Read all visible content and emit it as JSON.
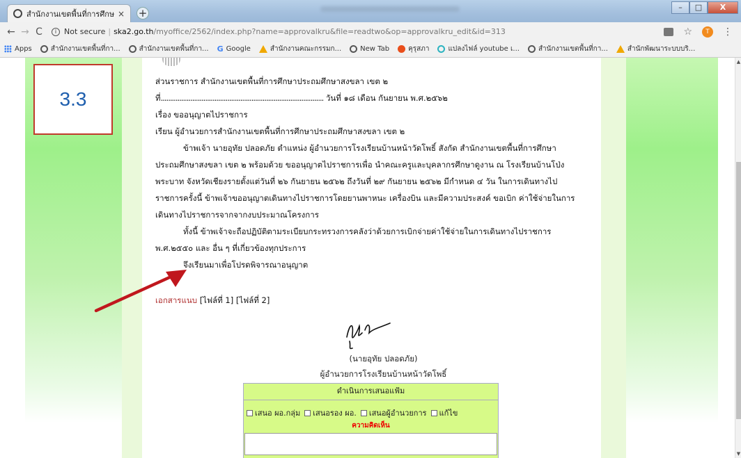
{
  "browser": {
    "tab_title": "สำนักงานเขตพื้นที่การศึกษาประถม",
    "tab_close": "×",
    "new_tab": "+",
    "window_buttons": {
      "minimize": "–",
      "maximize": "□",
      "close": "X"
    },
    "nav": {
      "back": "←",
      "forward": "→",
      "reload": "C"
    },
    "security_label": "Not secure",
    "url_host": "ska2.go.th",
    "url_path": "/myoffice/2562/index.php?name=approvalkru&file=readtwo&op=approvalkru_edit&id=313",
    "profile_initial": "T",
    "star": "☆",
    "menu": "⋮",
    "bookmarks": [
      {
        "icon": "apps-grid-icon",
        "label": "Apps"
      },
      {
        "icon": "globe-icon",
        "label": "สำนักงานเขตพื้นที่กา..."
      },
      {
        "icon": "globe-icon",
        "label": "สำนักงานเขตพื้นที่กา..."
      },
      {
        "icon": "google-icon",
        "label": "Google"
      },
      {
        "icon": "drive-icon",
        "label": "สำนักงานคณะกรรมก..."
      },
      {
        "icon": "globe-icon",
        "label": "New Tab"
      },
      {
        "icon": "fire-icon",
        "label": "คุรุสภา"
      },
      {
        "icon": "circle-icon",
        "label": "แปลงไฟล์ youtube เ..."
      },
      {
        "icon": "globe-icon",
        "label": "สำนักงานเขตพื้นที่กา..."
      },
      {
        "icon": "drive-icon",
        "label": "สำนักพัฒนาระบบบริ..."
      }
    ]
  },
  "annotation": {
    "label": "3.3"
  },
  "letter": {
    "agency": "ส่วนราชการ สำนักงานเขตพื้นที่การศึกษาประถมศึกษาสงขลา เขต ๒",
    "ref_prefix": "ที่",
    "ref_dots": "........................................................................................",
    "date": "วันที่ ๑๘ เดือน กันยายน พ.ศ.๒๕๖๒",
    "subject": "เรื่อง ขออนุญาตไปราชการ",
    "to": "เรียน ผู้อำนวยการสำนักงานเขตพื้นที่การศึกษาประถมศึกษาสงขลา เขต ๒",
    "body1_line1": "ข้าพเจ้า นายอุทัย ปลอดภัย ตำแหน่ง ผู้อำนวยการโรงเรียนบ้านหน้าวัดโพธิ์ สังกัด สำนักงานเขตพื้นที่การศึกษา",
    "body1_line2": "ประถมศึกษาสงขลา เขต ๒ พร้อมด้วย ขออนุญาตไปราชการเพื่อ นำคณะครูและบุคลากรศึกษาดูงาน ณ โรงเรียนบ้านโป่ง",
    "body1_line3": "พระบาท จังหวัดเชียงรายตั้งแต่วันที่ ๒๖ กันยายน ๒๕๖๒ ถึงวันที่ ๒๙ กันยายน ๒๕๖๒ มีกำหนด ๔ วัน ในการเดินทางไป",
    "body1_line4": "ราชการครั้งนี้ ข้าพเจ้าขออนุญาตเดินทางไปราชการโดยยานพาหนะ เครื่องบิน และมีความประสงค์ ขอเบิก ค่าใช้จ่ายในการ",
    "body1_line5": "เดินทางไปราชการจากจากงบประมาณโครงการ",
    "body2_line1": "ทั้งนี้ ข้าพเจ้าจะถือปฏิบัติตามระเบียบกระทรวงการคลังว่าด้วยการเบิกจ่ายค่าใช้จ่ายในการเดินทางไปราชการ",
    "body2_line2": "พ.ศ.๒๕๕๐ และ อื่น ๆ ที่เกี่ยวข้องทุกประการ",
    "closing": "จึงเรียนมาเพื่อโปรดพิจารณาอนุญาต",
    "attachments_label": "เอกสารแนบ",
    "file1": "[ไฟล์ที่ 1]",
    "file2": "[ไฟล์ที่ 2]",
    "signer_name": "(นายอุทัย ปลอดภัย)",
    "signer_title": "ผู้อำนวยการโรงเรียนบ้านหน้าวัดโพธิ์"
  },
  "action_panel": {
    "title": "ดำเนินการเสนอแฟ้ม",
    "options": [
      "เสนอ ผอ.กลุ่ม",
      "เสนอรอง ผอ.",
      "เสนอผู้อำนวยการ",
      "แก้ไข"
    ],
    "comment_label": "ความคิดเห็น",
    "comment_value": ""
  },
  "colors": {
    "accent_green": "#9ef08a",
    "panel_lime": "#d7fa88",
    "annotation_red": "#c0392b",
    "annotation_blue": "#1f5fae"
  }
}
